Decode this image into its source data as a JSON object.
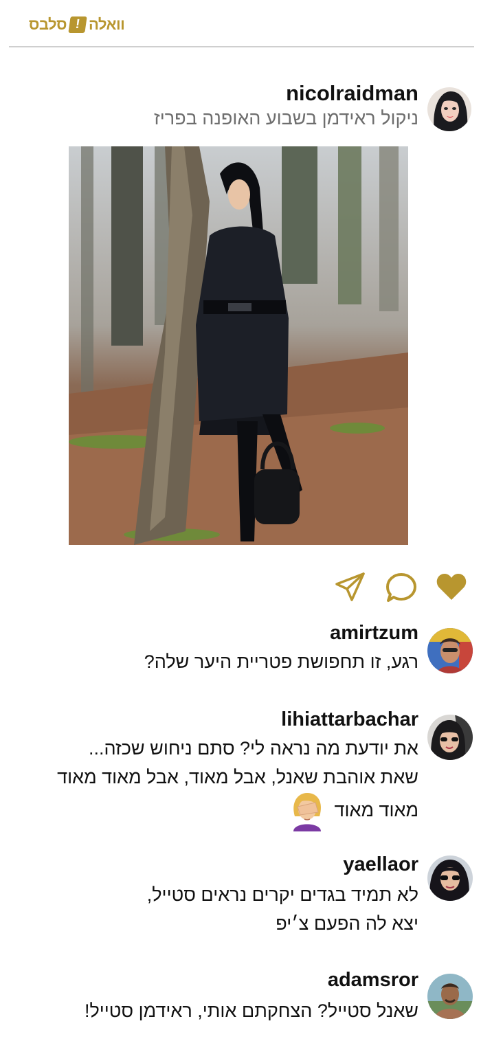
{
  "header": {
    "logo_left": "וואלה",
    "logo_mark": "!",
    "logo_right": "סלבס",
    "brand_color": "#b8962f"
  },
  "post": {
    "username": "nicolraidman",
    "caption": "ניקול ראידמן בשבוע האופנה בפריז",
    "photo_alt": "photo"
  },
  "actions": {
    "like_icon": "heart-icon",
    "comment_icon": "comment-icon",
    "share_icon": "send-icon",
    "accent": "#b8962f"
  },
  "comments": [
    {
      "username": "amirtzum",
      "lines": [
        "רגע, זו תחפושת פטריית היער שלה?"
      ]
    },
    {
      "username": "lihiattarbachar",
      "lines": [
        "את יודעת מה נראה לי? סתם ניחוש שכזה...",
        "שאת אוהבת שאנל, אבל מאוד, אבל מאוד מאוד",
        "מאוד מאוד"
      ],
      "emoji": "facepalm-emoji"
    },
    {
      "username": "yaellaor",
      "lines": [
        "לא תמיד בגדים יקרים נראים סטייל,",
        "יצא לה הפעם צ׳יפ"
      ]
    },
    {
      "username": "adamsror",
      "lines": [
        "שאנל סטייל? הצחקתם אותי, ראידמן סטייל!"
      ]
    }
  ]
}
